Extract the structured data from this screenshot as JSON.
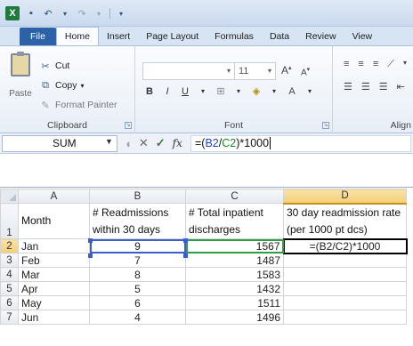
{
  "title_bar": {
    "app_logo": "X",
    "quick_access": [
      "save-icon",
      "undo-icon",
      "redo-icon",
      "customize-icon"
    ]
  },
  "tabs": [
    "File",
    "Home",
    "Insert",
    "Page Layout",
    "Formulas",
    "Data",
    "Review",
    "View"
  ],
  "ribbon": {
    "clipboard": {
      "label": "Clipboard",
      "paste": "Paste",
      "cut": "Cut",
      "copy": "Copy",
      "copy_arrow": "▾",
      "format_painter": "Format Painter"
    },
    "font": {
      "label": "Font",
      "size": "11",
      "bold": "B",
      "italic": "I",
      "underline": "U"
    },
    "alignment": {
      "label": "Align"
    }
  },
  "formula_bar": {
    "name_box": "SUM",
    "fx": "fx",
    "formula_prefix": "=(",
    "ref_b2": "B2",
    "slash": "/",
    "ref_c2": "C2",
    "formula_suffix": ")*1000"
  },
  "sheet": {
    "columns": [
      "A",
      "B",
      "C",
      "D"
    ],
    "selected_column": "D",
    "header_row": {
      "row": "1",
      "a": "Month",
      "b": "# Readmissions within 30 days",
      "c": "# Total inpatient discharges",
      "d": "30 day readmission rate (per 1000 pt dcs)"
    },
    "rows": [
      {
        "row": "2",
        "month": "Jan",
        "readmissions": "9",
        "discharges": "1567",
        "rate": "=(B2/C2)*1000"
      },
      {
        "row": "3",
        "month": "Feb",
        "readmissions": "7",
        "discharges": "1487",
        "rate": ""
      },
      {
        "row": "4",
        "month": "Mar",
        "readmissions": "8",
        "discharges": "1583",
        "rate": ""
      },
      {
        "row": "5",
        "month": "Apr",
        "readmissions": "5",
        "discharges": "1432",
        "rate": ""
      },
      {
        "row": "6",
        "month": "May",
        "readmissions": "6",
        "discharges": "1511",
        "rate": ""
      },
      {
        "row": "7",
        "month": "Jun",
        "readmissions": "4",
        "discharges": "1496",
        "rate": ""
      }
    ]
  },
  "colors": {
    "ref_b2": "#2146c7",
    "ref_c2": "#1a8a2b",
    "file_tab": "#2d62a8"
  }
}
